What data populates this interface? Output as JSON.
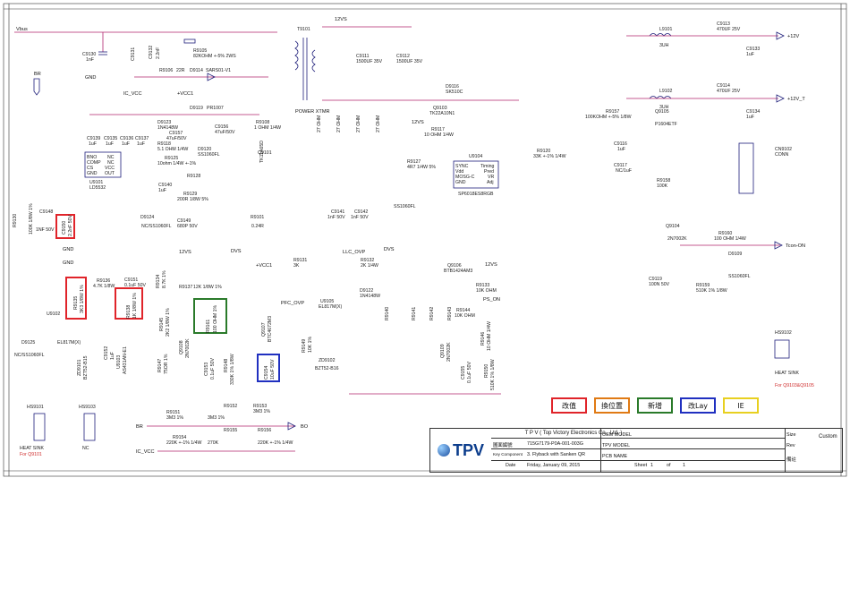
{
  "title_block": {
    "company": "T P V  ( Top  Victory  Electronics  Co.,  Ltd. )",
    "logo_text": "TPV",
    "doc_number_label": "圖面編號",
    "doc_number": "715G7179-P0A-001-003G",
    "key_component_label": "Key Component",
    "title": "3. Flyback with Sanken QR",
    "date_label": "Date",
    "date": "Friday, January 09, 2015",
    "oem_model_label": "OEM MODEL",
    "tpv_model_label": "TPV MODEL",
    "pcb_name_label": "PCB NAME",
    "sheet_label": "Sheet",
    "sheet_value": "1",
    "of_label": "of",
    "of_value": "1",
    "size_label": "Size",
    "size_value": "Custom",
    "rev_label": "Rev",
    "remark_label": "備註"
  },
  "legend": [
    {
      "label": "改值",
      "color": "#e0242a"
    },
    {
      "label": "換位置",
      "color": "#e07a14"
    },
    {
      "label": "新增",
      "color": "#2a7a2a"
    },
    {
      "label": "改Lay",
      "color": "#2030c0"
    },
    {
      "label": "IE",
      "color": "#e8d020"
    }
  ],
  "nets": {
    "vbus": "Vbus",
    "v12vs_top": "12VS",
    "v12v_out": "+12V",
    "v12vt_out": "+12V_T",
    "br": "BR",
    "ic_vcc": "IC_VCC",
    "vcc1": "+VCC1",
    "gnd": "GND",
    "tcon_on": "Tcon-ON",
    "llc_ovp": "LLC_OVP",
    "pfc_ovp": "PFC_OVP",
    "ps_on": "PS_ON",
    "bo": "BO",
    "v12vs_mid": "12VS",
    "dvs": "DVS",
    "power_xtmr": "POWER XTMR"
  },
  "components": {
    "t9101": "T9101",
    "u9101": "U9101",
    "u9101_part": "LD5532",
    "u9101_pins": [
      "BNO",
      "COMP",
      "CS",
      "GND",
      "NC",
      "NC",
      "VCC",
      "OUT"
    ],
    "u9104": "U9104",
    "u9104_part": "SP6018ES8RGB",
    "u9104_pins": [
      "SYNC",
      "Vdd",
      "MOSG-C",
      "GND",
      "Timing",
      "Pred",
      "VR",
      "Adj"
    ],
    "u9102": "U9102",
    "u9102_part": "EL817M(X)",
    "u9105": "U9105",
    "u9105_part": "EL817M(X)",
    "q9101": "Q9101",
    "q9101_part": "TK11A65D",
    "q9103": "Q9103",
    "q9103_part": "TK22A10N1",
    "q9105": "Q9105",
    "q9105_part": "P1604ETF",
    "q9104": "Q9104",
    "q9104_part": "2N7002K",
    "q9106": "Q9106",
    "q9106_part": "BTB1424AM3",
    "q9107": "Q9107",
    "q9107_part": "BTC4672M3",
    "q9108": "Q9108",
    "q9108_part": "2N7002K",
    "cn9102": "CN9102",
    "cn9102_part": "CONN",
    "l9101": "L9101",
    "l9101_val": "3UH",
    "l9102": "L9102",
    "l9102_val": "3UH",
    "c9113": "C9113",
    "c9113_val": "470UF 25V",
    "c9114": "C9114",
    "c9114_val": "470UF 25V",
    "c9133": "C9133",
    "c9133_val": "1uF",
    "c9134": "C9134",
    "c9134_val": "1uF",
    "c9111": "C9111",
    "c9111_val": "1500UF 35V",
    "c9112": "C9112",
    "c9112_val": "1500UF 35V",
    "d9116": "D9116",
    "d9116_part": "SK510C",
    "d9114": "D9114",
    "d9114_part": "SARS01-V1",
    "r9105": "R9105",
    "r9105_val": "82KOHM +-5% 2WS",
    "r9106": "R9106",
    "r9106_val": "22R",
    "r9108": "R9108",
    "r9108_val": "1 OHM 1/4W",
    "r9157": "R9157",
    "r9157_val": "100KOHM +-5% 1/8W",
    "r9158": "R9158",
    "r9158_val": "100K",
    "r9160": "R9160",
    "r9160_val": "100 OHM 1/4W",
    "d9109": "D9109",
    "d9109_part": "SS1060FL",
    "r9159": "R9159",
    "r9159_val": "510K 1% 1/8W",
    "c9119": "C9119",
    "c9119_val": "100N 50V",
    "hs9102": "HS9102",
    "hs9102_label": "HEAT SINK",
    "hs9102_note": "For Q9103&Q9105",
    "hs9101": "HS9101",
    "hs9101_label": "HEAT SINK",
    "hs9101_note": "For Q9101",
    "hs9103": "HS9103",
    "hs9103_label": "NC",
    "d9125": "D9125",
    "d9125_part": "NC/SS1060FL",
    "r9151": "R9151",
    "r9151_val": "3M3 1%",
    "r9152": "R9152",
    "r9152_val": "3M3 1%",
    "r9153": "R9153",
    "r9153_val": "3M3 1%",
    "r9154": "R9154",
    "r9154_val": "220K +-1% 1/4W",
    "r9155": "R9155",
    "r9155_val": "270K",
    "r9156": "R9156",
    "r9156_val": "220K +-1% 1/4W",
    "c9130": "C9130",
    "c9130_val": "1nF",
    "c9131": "C9131",
    "c9131_val": "2.2nF",
    "c9132": "C9132",
    "c9132_val": "2.2nF",
    "r9101": "R9101",
    "r9101_val": "0.24R",
    "r9131": "R9131",
    "r9131_val": "3K",
    "r9132": "R9132",
    "r9132_val": "2K 1/4W",
    "r9133": "R9133",
    "r9133_val": "10K OHM",
    "d9122": "D9122",
    "d9122_part": "1N4148W",
    "zd9102": "ZD9102",
    "zd9102_part": "BZT52-B16",
    "r9117": "R9117",
    "r9117_val": "10 OHM 1/4W",
    "r9127": "R9127",
    "r9127_val": "4R7 1/4W 5%",
    "r9120": "R9120",
    "r9120_val": "33K +-1% 1/4W",
    "d9121": "D9121",
    "d9121_part": "SS1060FL",
    "r9128": "R9128",
    "r9128_val": "5.1 OHM 1/4W",
    "r9129": "R9129",
    "r9129_val": "200R 1/8W 5%",
    "r9125": "R9125",
    "r9125_val": "10ohm 1/4W +-1%",
    "d9120": "D9120",
    "d9120_part": "SS1060FL",
    "d9123": "D9123",
    "d9123_part": "1N4148W",
    "d9119": "D9119",
    "d9119_part": "PR1007",
    "c9157": "C9157",
    "c9157_val": "47uF/50V",
    "c9156": "C9156",
    "c9156_val": "47uF/50V",
    "d9124": "D9124",
    "c9149": "C9149",
    "c9149_val": "680P 50V",
    "c9140": "C9140",
    "c9140_val": "1uF",
    "r9130": "R9130",
    "r9130_val": "100K 1/8W 1%",
    "c9148": "C9148",
    "c9148_val": "1NF 50V",
    "c9150": "C9150",
    "c9150_val": "2.2nF 50V",
    "r9135": "R9135",
    "r9135_val": "3K3 1/8W 1%",
    "r9136": "R9136",
    "r9136_val": "4.7K 1/8W",
    "c9151": "C9151",
    "c9151_val": "0.1uF 50V",
    "r9138": "R9138",
    "r9138_val": "1K 1/8W 1%",
    "r9137": "R9137",
    "r9137_val": "12K 1/8W 1%",
    "r9161": "R9161",
    "r9161_val": "100 OHM 1%",
    "r9134": "R9134",
    "r9134_val": "8.7K 1%",
    "zd9101": "ZD9101",
    "zd9101_part": "BZT52-B15",
    "u9103": "U9103",
    "u9103_part": "AS431AN-E1",
    "c9152": "C9152",
    "c9152_val": "1uF",
    "c9154": "C9154",
    "c9154_val": "10uF 50V",
    "d9121b": "D9121",
    "c9141": "C9141",
    "c9141_val": "1nF 50V",
    "c9142": "C9142",
    "c9142_val": "1nF 50V",
    "c9143": "C9143",
    "c9143_val": "1uF",
    "c9145": "C9145",
    "c9145_val": "220P 50V",
    "c9146": "C9146",
    "c9146_val": "0.1uF 50V",
    "c9147": "C9147",
    "c9147_val": "100PF 50V",
    "c9138": "C9138",
    "c9138_val": "0.1uF 50V",
    "r9147": "R9147",
    "r9147_val": "75OR 1%",
    "c9153": "C9153",
    "c9153_val": "0.1uF 50V",
    "r9148": "R9148",
    "r9148_val": "330K 1% 1/8W",
    "r9149": "R9149",
    "r9149_val": "10K 1%",
    "r9145": "R9145",
    "r9145_val": "2K2 1/8W 1%",
    "r9146": "R9146",
    "r9146_val": "10 OHM 1/4W",
    "r9150": "R9150",
    "r9150_val": "510K 1% 1/8W",
    "c9155": "C9155",
    "c9155_val": "0.1uF 50V",
    "q9109": "Q9109",
    "q9109_part": "2N7002K",
    "r9140": "R9140",
    "r9141": "R9141",
    "r9142": "R9142",
    "r9143": "R9143",
    "r9144": "R9144",
    "r9144_val": "10K OHM",
    "r_ohm_27": "27 OHM",
    "c9116": "C9116",
    "c9116_val": "1uF",
    "c9117": "C9117",
    "c9117_val": "NC/1uF",
    "c9139": "C9139",
    "c9135": "C9135",
    "c9136": "C9136",
    "c9137": "C9137",
    "cap_1uf": "1uF",
    "r9118": "R9118",
    "r9118_val": "10K OHM 1% 1/8W"
  }
}
